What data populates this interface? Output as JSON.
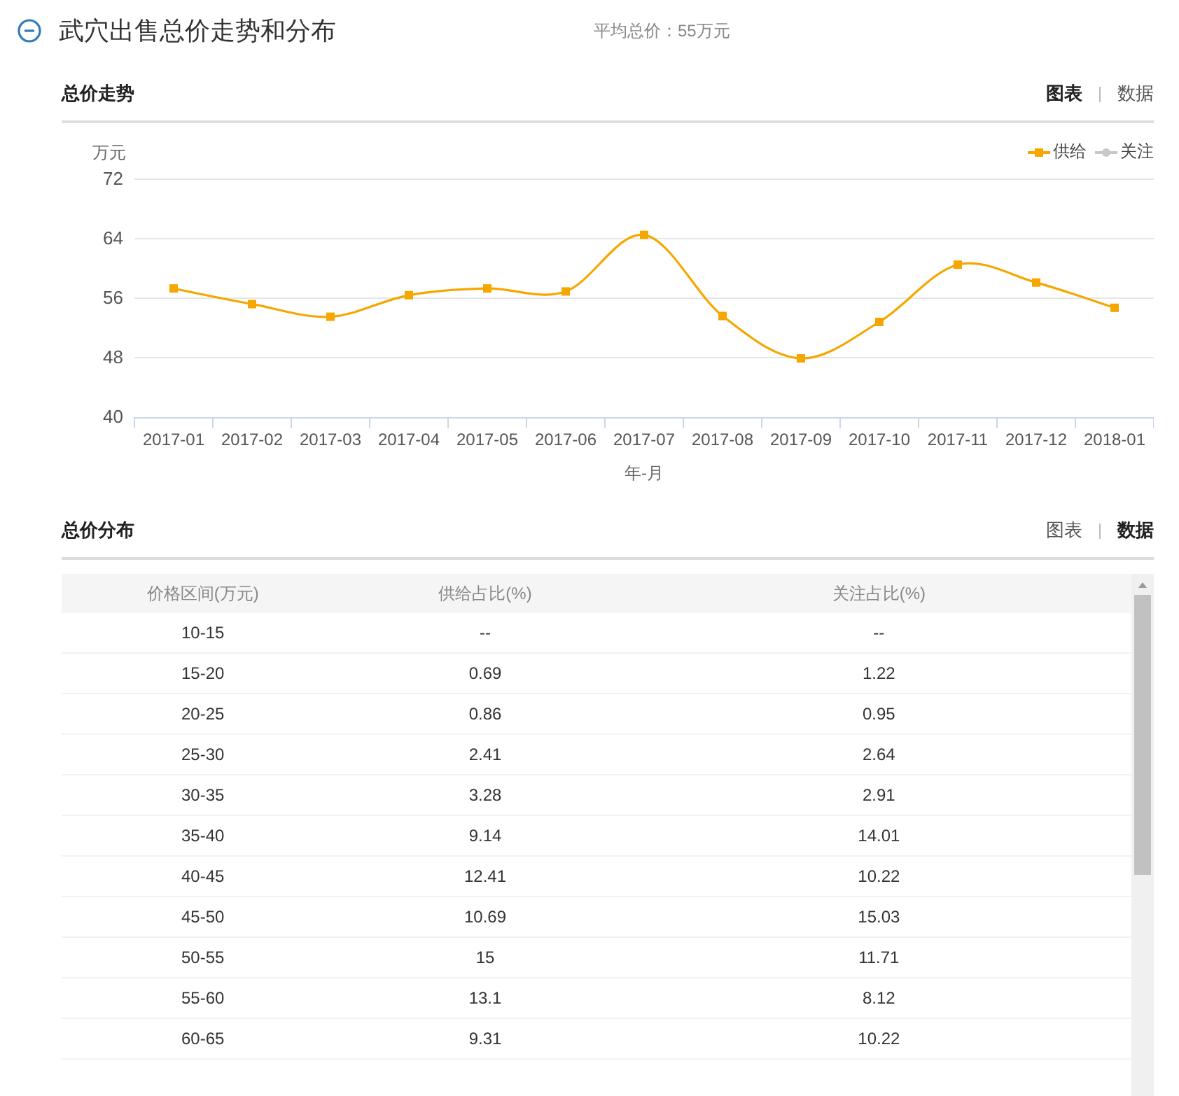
{
  "header": {
    "title": "武穴出售总价走势和分布",
    "summary": "平均总价：55万元"
  },
  "trend": {
    "title": "总价走势",
    "toggles": [
      {
        "label": "图表",
        "selected": true
      },
      {
        "label": "数据",
        "selected": false
      }
    ],
    "chart_data": {
      "type": "line",
      "ylabel": "万元",
      "xlabel": "年-月",
      "categories": [
        "2017-01",
        "2017-02",
        "2017-03",
        "2017-04",
        "2017-05",
        "2017-06",
        "2017-07",
        "2017-08",
        "2017-09",
        "2017-10",
        "2017-11",
        "2017-12",
        "2018-01"
      ],
      "series": [
        {
          "name": "供给",
          "color": "#f5a700",
          "marker": "square",
          "values": [
            57.3,
            55.2,
            53.5,
            56.4,
            57.3,
            56.9,
            64.5,
            53.6,
            47.9,
            52.8,
            60.5,
            58.1,
            54.7
          ]
        },
        {
          "name": "关注",
          "color": "#c8c8c8",
          "marker": "circle",
          "values": [
            null,
            null,
            null,
            null,
            null,
            null,
            null,
            null,
            null,
            null,
            null,
            null,
            null
          ]
        }
      ],
      "ylim": [
        40,
        72
      ],
      "yticks": [
        40,
        48,
        56,
        64,
        72
      ],
      "grid": true
    }
  },
  "distribution": {
    "title": "总价分布",
    "toggles": [
      {
        "label": "图表",
        "selected": false
      },
      {
        "label": "数据",
        "selected": true
      }
    ],
    "table": {
      "columns": [
        "价格区间(万元)",
        "供给占比(%)",
        "关注占比(%)"
      ],
      "rows": [
        [
          "10-15",
          "--",
          "--"
        ],
        [
          "15-20",
          "0.69",
          "1.22"
        ],
        [
          "20-25",
          "0.86",
          "0.95"
        ],
        [
          "25-30",
          "2.41",
          "2.64"
        ],
        [
          "30-35",
          "3.28",
          "2.91"
        ],
        [
          "35-40",
          "9.14",
          "14.01"
        ],
        [
          "40-45",
          "12.41",
          "10.22"
        ],
        [
          "45-50",
          "10.69",
          "15.03"
        ],
        [
          "50-55",
          "15",
          "11.71"
        ],
        [
          "55-60",
          "13.1",
          "8.12"
        ],
        [
          "60-65",
          "9.31",
          "10.22"
        ]
      ]
    }
  }
}
